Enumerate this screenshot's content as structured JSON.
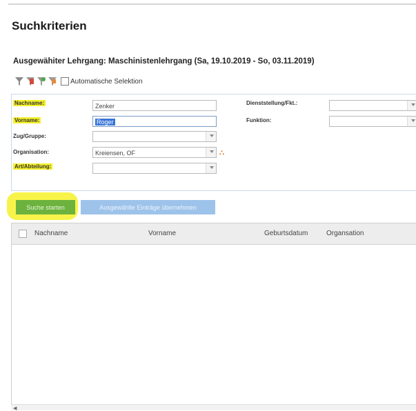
{
  "page": {
    "title": "Suchkriterien",
    "course": "Ausgewähiter Lehrgang: Maschinistenlehrgang (Sa, 19.10.2019 - So, 03.11.2019)"
  },
  "filters": {
    "auto_select_label": "Automatische Selektion",
    "icons": [
      "funnel-gray-icon",
      "funnel-red-icon",
      "funnel-green-icon",
      "funnel-orange-icon"
    ]
  },
  "form": {
    "nachname_label": "Nachname:",
    "nachname_value": "Zenker",
    "vorname_label": "Vorname:",
    "vorname_value": "Roger",
    "zug_label": "Zug/Gruppe:",
    "zug_value": "",
    "org_label": "Organisation:",
    "org_value": "Kreiensen, OF",
    "art_label": "Art/Abteilung:",
    "art_value": "",
    "dienst_label": "Dienststellung/Fkt.:",
    "dienst_value": "",
    "funktion_label": "Funktion:",
    "funktion_value": ""
  },
  "buttons": {
    "search": "Suche starten",
    "take": "Ausgewählte Einträge übernehmen"
  },
  "grid": {
    "columns": [
      "Nachname",
      "Vorname",
      "Geburtsdatum",
      "Organsation"
    ]
  },
  "colors": {
    "highlight": "#f4f02a",
    "search_button": "#6cb23e",
    "take_button": "#9ec3ea",
    "share_icon": "#e07a2a"
  }
}
